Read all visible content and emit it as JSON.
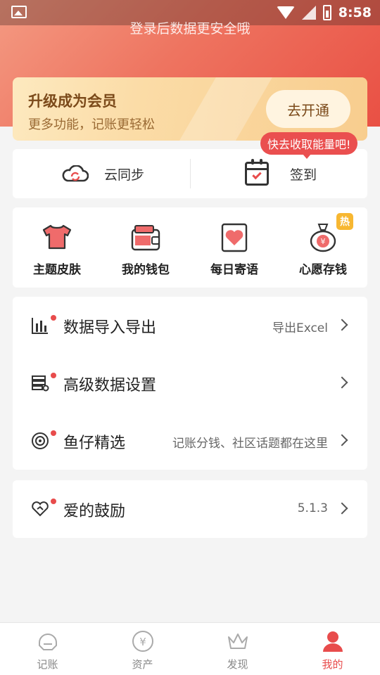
{
  "status_bar": {
    "time": "8:58"
  },
  "header": {
    "login_hint": "登录后数据更安全哦"
  },
  "vip": {
    "title": "升级成为会员",
    "subtitle": "更多功能，记账更轻松",
    "button": "去开通"
  },
  "energy_tip": "快去收取能量吧!",
  "sync": {
    "cloud_label": "云同步",
    "checkin_label": "签到"
  },
  "grid": [
    {
      "label": "主题皮肤",
      "icon": "tshirt-icon"
    },
    {
      "label": "我的钱包",
      "icon": "wallet-icon"
    },
    {
      "label": "每日寄语",
      "icon": "heart-card-icon"
    },
    {
      "label": "心愿存钱",
      "icon": "money-bag-icon",
      "badge": "热"
    }
  ],
  "settings": [
    {
      "title": "数据导入导出",
      "value": "导出Excel",
      "icon": "bar-chart-icon"
    },
    {
      "title": "高级数据设置",
      "value": "",
      "icon": "data-settings-icon"
    },
    {
      "title": "鱼仔精选",
      "value": "记账分钱、社区话题都在这里",
      "icon": "target-icon"
    }
  ],
  "encourage": {
    "title": "爱的鼓励",
    "version": "5.1.3",
    "icon": "heart-hand-icon"
  },
  "tabs": [
    {
      "label": "记账",
      "icon": "ledger-icon"
    },
    {
      "label": "资产",
      "icon": "yuan-icon"
    },
    {
      "label": "发现",
      "icon": "crown-icon"
    },
    {
      "label": "我的",
      "icon": "person-icon",
      "active": true
    }
  ],
  "colors": {
    "accent": "#e84c4c",
    "vip_text": "#7b4a1a",
    "badge": "#f7b731"
  }
}
